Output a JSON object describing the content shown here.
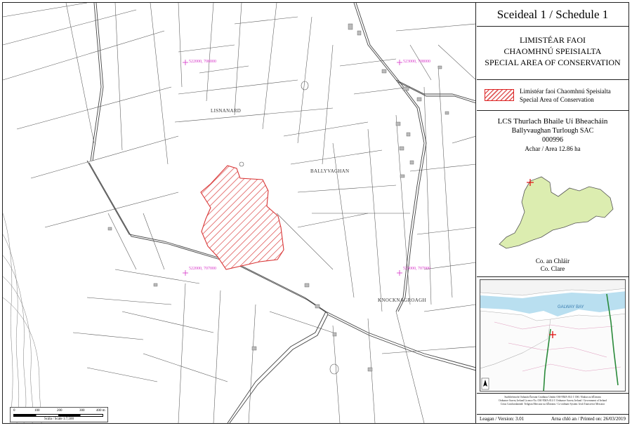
{
  "schedule_title": "Sceideal 1 / Schedule 1",
  "heading": {
    "line1": "LIMISTÉAR FAOI",
    "line2": "CHAOMHNÚ SPEISIALTA",
    "line3": "SPECIAL AREA OF CONSERVATION"
  },
  "legend": {
    "irish": "Limistéar faoi Chaomhnú Speisialta",
    "english": "Special Area of Conservation",
    "swatch_color": "#d93636"
  },
  "site": {
    "name_irish": "LCS Thurlach Bhaile Uí Bheacháin",
    "name_english": "Ballyvaughan Turlough SAC",
    "code": "000996",
    "area": "Achar / Area 12.86 ha",
    "county_irish": "Co. an Chláir",
    "county_english": "Co. Clare",
    "county_fill": "#dcedb0"
  },
  "map": {
    "townlands": [
      "LISNANARD",
      "BALLYVAGHAN",
      "KNOCKNAGROAGH"
    ],
    "grid_labels": [
      "522000, 708000",
      "523000, 708000",
      "522000, 707000",
      "523000, 707000"
    ],
    "grid_color": "#d633c8",
    "sac_color": "#d93636",
    "scale_ticks": [
      "0",
      "100",
      "200",
      "300",
      "400 m"
    ],
    "scale_text": "Scála / Scale 1:7,500"
  },
  "location_map": {
    "bay_label": "GALWAY BAY"
  },
  "copyright": [
    "Suirbhéireacht Ordanáis Éireann Ceadúnas Uimhir OSI-NMA-014 © OSI / Rialtas na hÉireann",
    "Ordnance Survey Ireland Licence No. OSI-NMA-014 © Ordnance Survey Ireland / Government of Ireland",
    "Córas Comhordanáidí: Teilgean Mercator na hÉireann / Co-ordinate System: Irish Transverse Mercator"
  ],
  "footer": {
    "version": "Leagan / Version: 3.01",
    "printed": "Arna chló an / Printed on: 26/03/2019"
  }
}
